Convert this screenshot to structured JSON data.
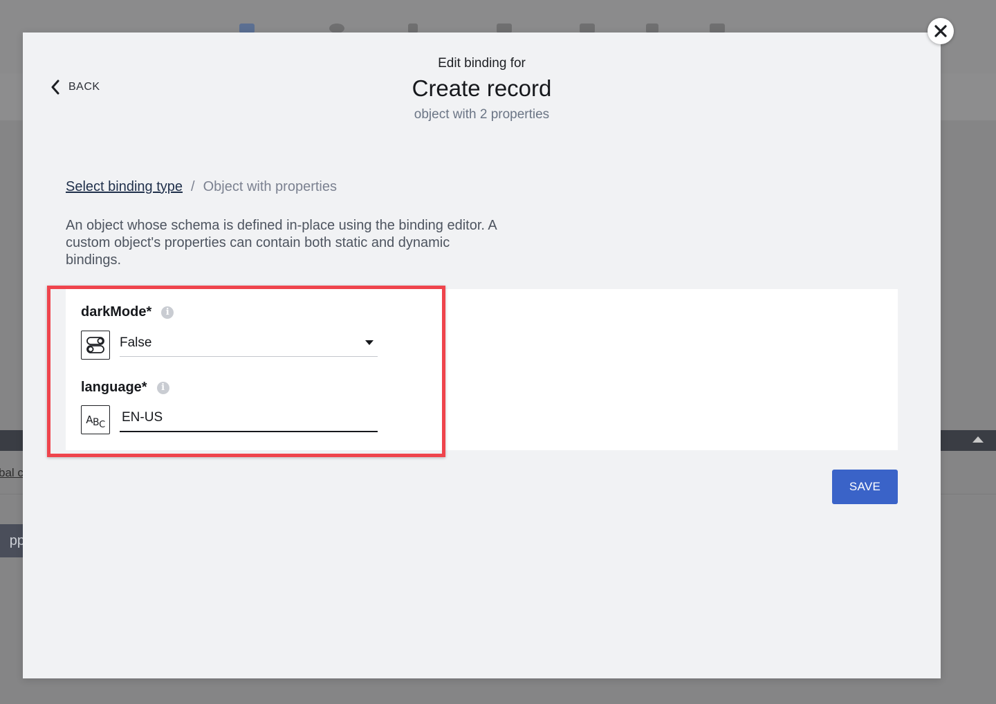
{
  "background": {
    "global_link": "bal c",
    "app_button": "pp"
  },
  "modal": {
    "back_label": "BACK",
    "header": {
      "pre_title": "Edit binding for",
      "title": "Create record",
      "subtitle": "object with 2 properties"
    },
    "breadcrumb": {
      "link": "Select binding type",
      "separator": "/",
      "current": "Object with properties"
    },
    "description": "An object whose schema is defined in-place using the binding editor. A custom object's properties can contain both static and dynamic bindings.",
    "properties": [
      {
        "label": "darkMode*",
        "type_icon": "toggle-icon",
        "control": "select",
        "value": "False"
      },
      {
        "label": "language*",
        "type_icon": "abc-text-icon",
        "control": "text",
        "value": "EN-US"
      }
    ],
    "save_label": "SAVE"
  },
  "colors": {
    "primary": "#3a63c8",
    "highlight": "#ef444c",
    "modal_bg": "#f1f2f4",
    "overlay_bg": "#8a8a8b"
  }
}
